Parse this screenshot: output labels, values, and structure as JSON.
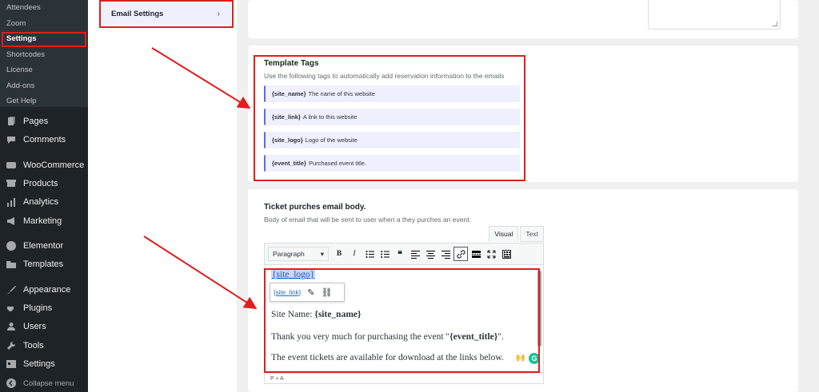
{
  "admin_menu": {
    "submenu": [
      {
        "label": "Attendees"
      },
      {
        "label": "Zoom"
      },
      {
        "label": "Settings",
        "active": true
      },
      {
        "label": "Shortcodes"
      },
      {
        "label": "License"
      },
      {
        "label": "Add-ons"
      },
      {
        "label": "Get Help"
      }
    ],
    "items": [
      {
        "label": "Pages",
        "icon": "pages-icon"
      },
      {
        "label": "Comments",
        "icon": "comments-icon"
      },
      {
        "label": "WooCommerce",
        "icon": "woocommerce-icon"
      },
      {
        "label": "Products",
        "icon": "products-icon"
      },
      {
        "label": "Analytics",
        "icon": "analytics-icon"
      },
      {
        "label": "Marketing",
        "icon": "marketing-icon"
      },
      {
        "label": "Elementor",
        "icon": "elementor-icon"
      },
      {
        "label": "Templates",
        "icon": "templates-icon"
      },
      {
        "label": "Appearance",
        "icon": "appearance-icon"
      },
      {
        "label": "Plugins",
        "icon": "plugins-icon"
      },
      {
        "label": "Users",
        "icon": "users-icon"
      },
      {
        "label": "Tools",
        "icon": "tools-icon"
      },
      {
        "label": "Settings",
        "icon": "settings-icon"
      },
      {
        "label": "Collapse menu",
        "icon": "collapse-icon"
      }
    ]
  },
  "settings_tabs": {
    "email_settings": "Email Settings",
    "chevron": "›"
  },
  "template_tags": {
    "title": "Template Tags",
    "description": "Use the following tags to automatically add reservation information to the emails",
    "tags": [
      {
        "tag": "{site_name}",
        "text": "The name of this website"
      },
      {
        "tag": "{site_link}",
        "text": "A link to this website"
      },
      {
        "tag": "{site_logo}",
        "text": "Logo of the website"
      },
      {
        "tag": "{event_title}",
        "text": "Purchased event title."
      }
    ]
  },
  "email_body": {
    "title": "Ticket purches email body.",
    "description": "Body of email that will be sent to user when a they purches an event.",
    "tab_visual": "Visual",
    "tab_text": "Text",
    "format_select": "Paragraph",
    "content": {
      "logo_tag": "{site_logo}",
      "link_popup_text": "{site_link}",
      "site_name_label": "Site Name: ",
      "site_name_tag": "{site_name}",
      "thanks_prefix": "Thank you very much for purchasing the event \"",
      "thanks_tag": "{event_title}",
      "thanks_suffix": "\".",
      "download_line": "The event tickets are available for download at the links below."
    },
    "status_path": "P » A"
  },
  "colors": {
    "highlight": "#e11d1d",
    "accent": "#6366f1",
    "sidebar_bg": "#1d2327"
  }
}
